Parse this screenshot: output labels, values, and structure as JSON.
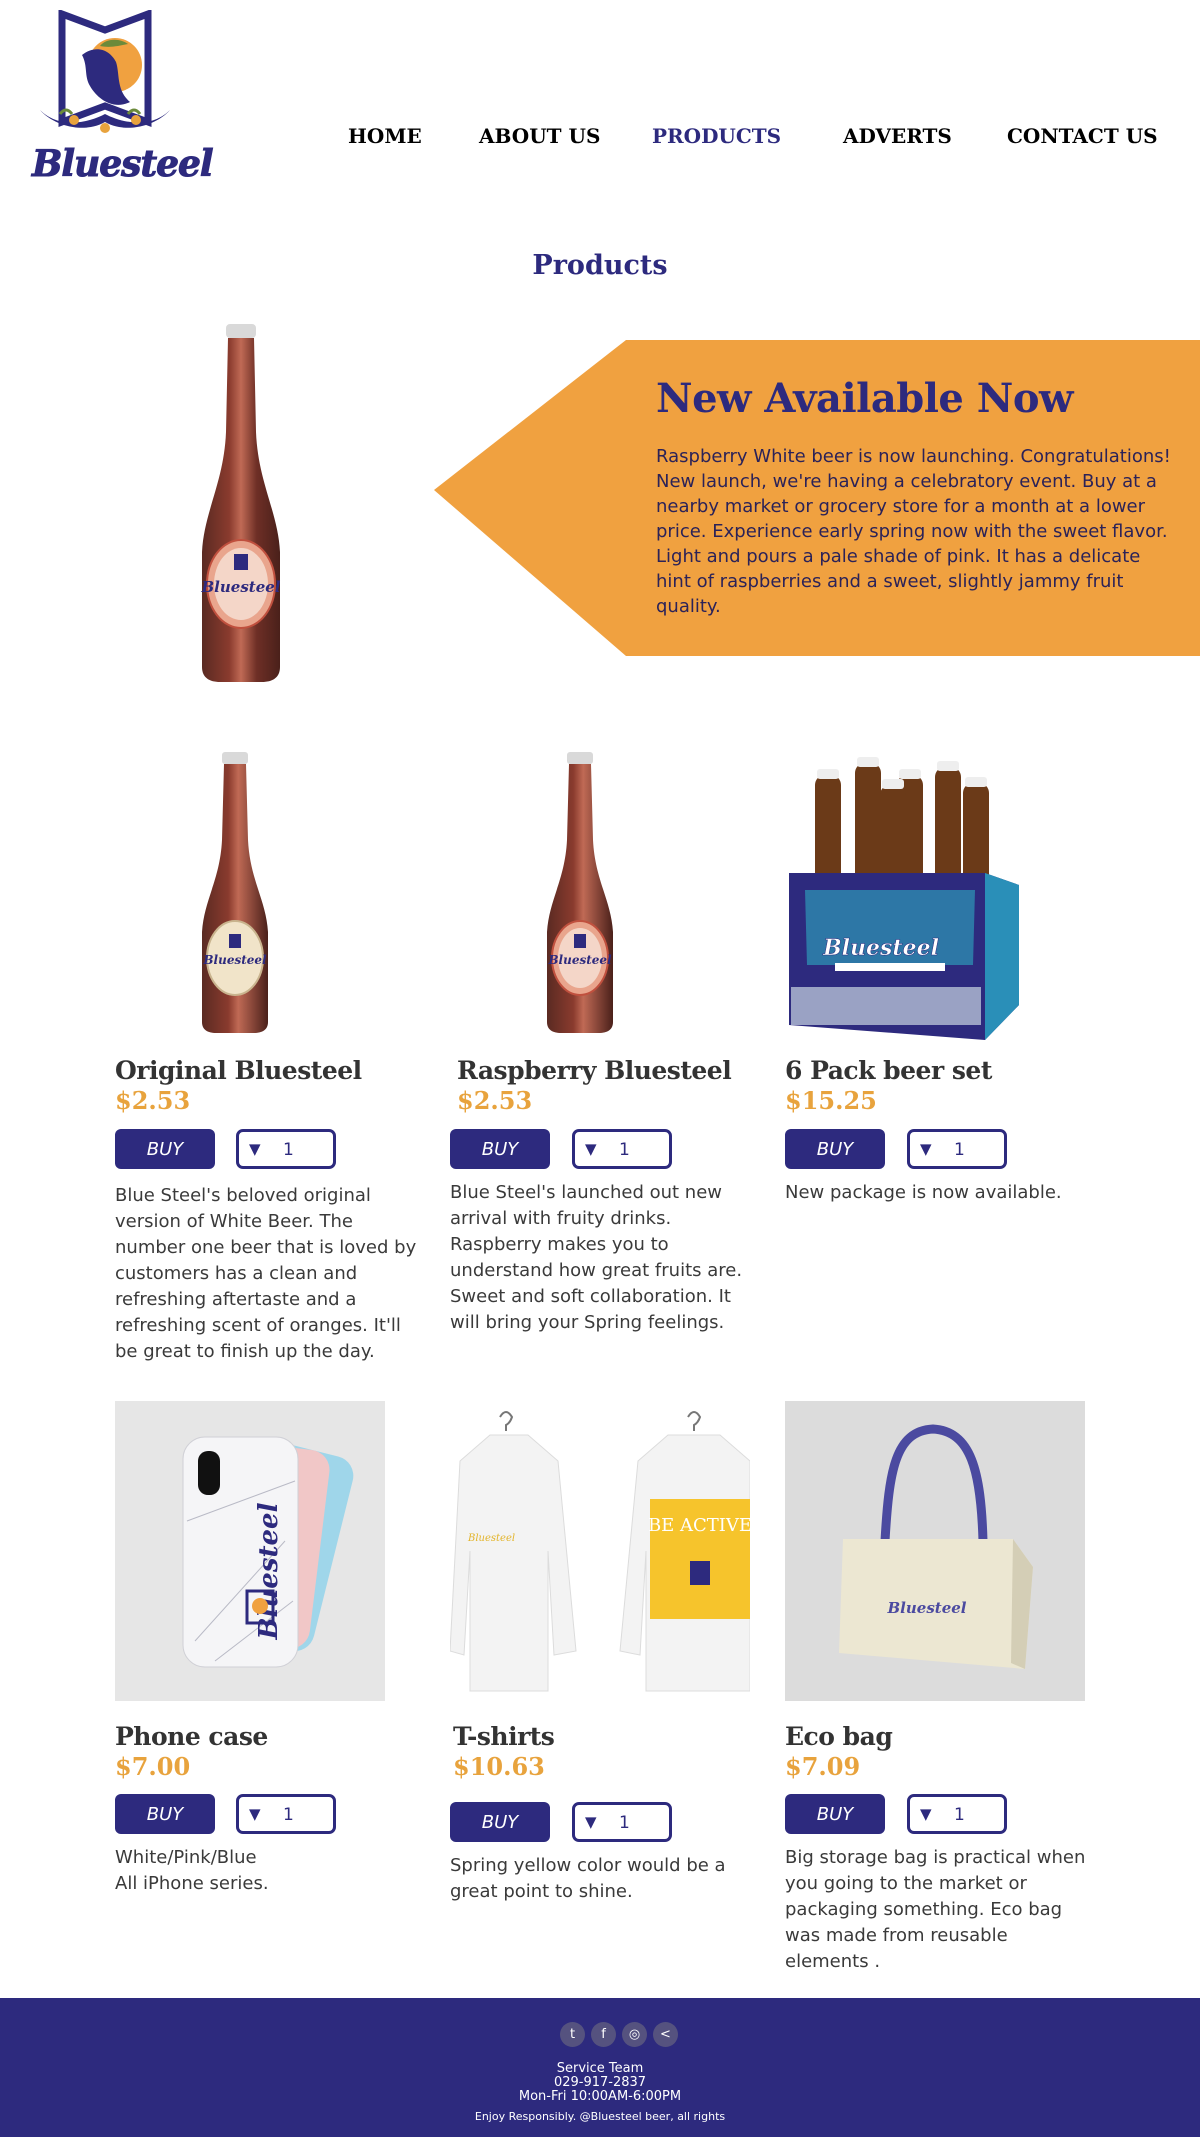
{
  "brand": {
    "name": "Bluesteel"
  },
  "nav": {
    "items": [
      "HOME",
      "ABOUT US",
      "PRODUCTS",
      "ADVERTS",
      "CONTACT US"
    ],
    "active": "PRODUCTS"
  },
  "page": {
    "title": "Products"
  },
  "hero": {
    "title": "New Available Now",
    "text": "Raspberry White beer is now launching. Congratulations! New launch, we're having a celebratory event. Buy at a nearby market or grocery store for a month at a lower price. Experience early spring now with the sweet flavor. Light and pours a pale shade of pink. It has a delicate hint of raspberries and a sweet, slightly jammy fruit quality."
  },
  "buy_label": "BUY",
  "products": [
    {
      "name": "Original  Bluesteel",
      "price": "$2.53",
      "qty": "1",
      "desc": "Blue Steel's beloved original version of White Beer. The number one beer that is loved by customers has a clean and refreshing aftertaste and a refreshing scent of oranges. It'll be great to finish up the day."
    },
    {
      "name": "Raspberry Bluesteel",
      "price": "$2.53",
      "qty": "1",
      "desc": "Blue Steel's launched out new arrival with fruity drinks. Raspberry makes you to understand how great fruits are. Sweet and soft collaboration. It will bring your Spring feelings."
    },
    {
      "name": "6 Pack beer set",
      "price": "$15.25",
      "qty": "1",
      "desc": "New package is now available."
    },
    {
      "name": "Phone case",
      "price": "$7.00",
      "qty": "1",
      "desc": "White/Pink/Blue\nAll iPhone series."
    },
    {
      "name": "T-shirts",
      "price": "$10.63",
      "qty": "1",
      "desc": "Spring yellow color would be a great point to shine."
    },
    {
      "name": "Eco bag",
      "price": "$7.09",
      "qty": "1",
      "desc": "Big storage bag is practical when you going to the market or packaging something.  Eco bag was made from reusable elements ."
    }
  ],
  "images": {
    "shirt_text": "BE ACTIVE",
    "shirt_small_text": "Bluesteel"
  },
  "footer": {
    "socials": [
      "twitter-icon",
      "facebook-icon",
      "instagram-icon",
      "share-icon"
    ],
    "team": "Service Team",
    "phone": "029-917-2837",
    "hours": "Mon-Fri 10:00AM-6:00PM",
    "legal": "Enjoy Responsibly. @Bluesteel beer, all rights"
  },
  "colors": {
    "brand": "#2d2a7e",
    "accent": "#f0a140",
    "price": "#e8a33d",
    "footer": "#2d2a7e"
  }
}
